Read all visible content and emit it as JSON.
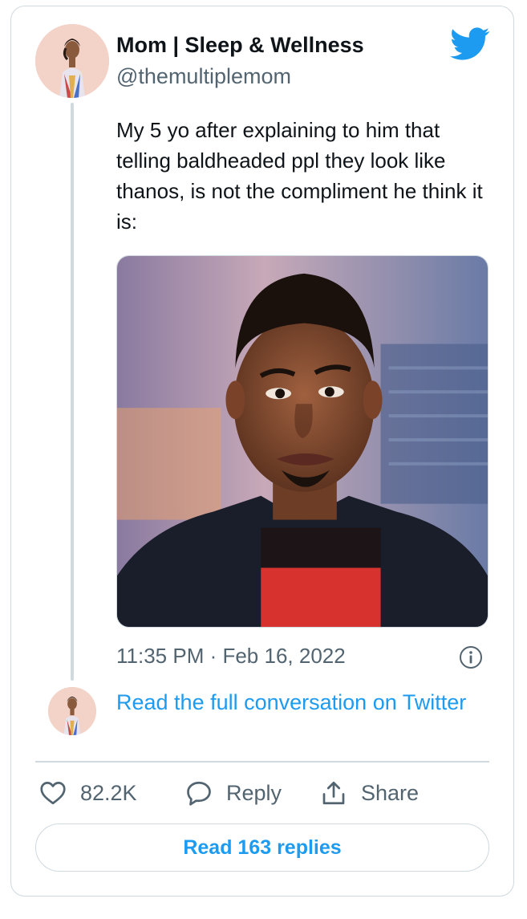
{
  "author": {
    "display_name": "Mom | Sleep & Wellness",
    "handle": "@themultiplemom",
    "avatar_icon": "profile-photo"
  },
  "tweet": {
    "text": "My 5 yo after explaining to him that telling baldheaded ppl they look like thanos, is not the compliment he think it is:",
    "media_icon": "photo-of-man-making-skeptical-face",
    "timestamp": "11:35 PM · Feb 16, 2022"
  },
  "conversation": {
    "read_full_label": "Read the full conversation on Twitter"
  },
  "actions": {
    "like_count": "82.2K",
    "reply_label": "Reply",
    "share_label": "Share"
  },
  "replies_button_label": "Read 163 replies",
  "colors": {
    "accent": "#1d9bf0",
    "secondary_text": "#536471",
    "border": "#cfd9de"
  }
}
